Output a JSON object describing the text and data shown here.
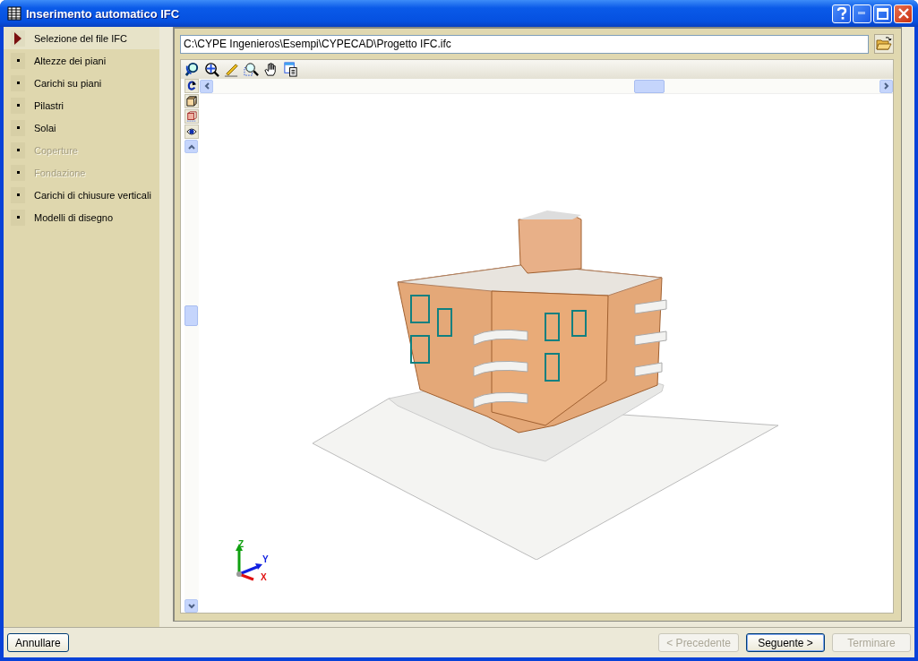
{
  "window": {
    "title": "Inserimento automatico IFC"
  },
  "steps": [
    {
      "label": "Selezione del file IFC",
      "selected": true,
      "disabled": false
    },
    {
      "label": "Altezze dei piani",
      "selected": false,
      "disabled": false
    },
    {
      "label": "Carichi su piani",
      "selected": false,
      "disabled": false
    },
    {
      "label": "Pilastri",
      "selected": false,
      "disabled": false
    },
    {
      "label": "Solai",
      "selected": false,
      "disabled": false
    },
    {
      "label": "Coperture",
      "selected": false,
      "disabled": true
    },
    {
      "label": "Fondazione",
      "selected": false,
      "disabled": true
    },
    {
      "label": "Carichi di chiusure verticali",
      "selected": false,
      "disabled": false
    },
    {
      "label": "Modelli di disegno",
      "selected": false,
      "disabled": false
    }
  ],
  "file_path": {
    "value": "C:\\CYPE Ingenieros\\Esempi\\CYPECAD\\Progetto IFC.ifc"
  },
  "axes": {
    "x": "X",
    "y": "Y",
    "z": "Z"
  },
  "cancel_button": {
    "label": "Annullare"
  },
  "nav_buttons": [
    {
      "label": "< Precedente",
      "disabled": true,
      "default": false
    },
    {
      "label": "Seguente >",
      "disabled": false,
      "default": true
    },
    {
      "label": "Terminare",
      "disabled": true,
      "default": false
    }
  ]
}
